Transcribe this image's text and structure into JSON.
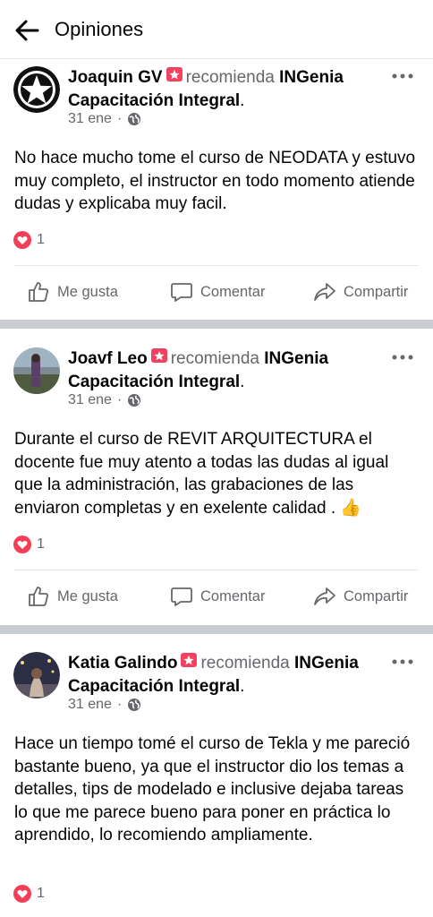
{
  "header": {
    "title": "Opiniones",
    "back_icon": "arrow-left-icon"
  },
  "common": {
    "recommends": "recomienda",
    "page_name_1": "INGenia",
    "page_name_2": "Capacitación Integral",
    "period": ".",
    "like_label": "Me gusta",
    "comment_label": "Comentar",
    "share_label": "Compartir"
  },
  "colors": {
    "love": "#f33e58",
    "recommend_badge": "#f3425f",
    "secondary_text": "#65676b",
    "divider": "#c9ccd1"
  },
  "posts": [
    {
      "author": "Joaquin GV",
      "date": "31 ene",
      "privacy_icon": "globe-icon",
      "text": "No hace mucho tome el curso de NEODATA y estuvo muy completo, el instructor en todo momento atiende dudas y explicaba muy facil.",
      "reaction_count": "1"
    },
    {
      "author": "Joavf Leo",
      "date": "31 ene",
      "privacy_icon": "globe-icon",
      "text": "Durante el curso de REVIT ARQUITECTURA el docente fue muy atento a todas las dudas al igual que la administración, las grabaciones de las enviaron completas y en exelente calidad . 👍",
      "reaction_count": "1"
    },
    {
      "author": "Katia Galindo",
      "date": "31 ene",
      "privacy_icon": "globe-icon",
      "text": "Hace un tiempo tomé el curso de Tekla y me pareció bastante bueno, ya que el instructor dio los temas a detalles, tips de modelado e inclusive dejaba tareas lo que me parece bueno para poner en práctica lo aprendido, lo recomiendo ampliamente.",
      "reaction_count": "1"
    }
  ]
}
